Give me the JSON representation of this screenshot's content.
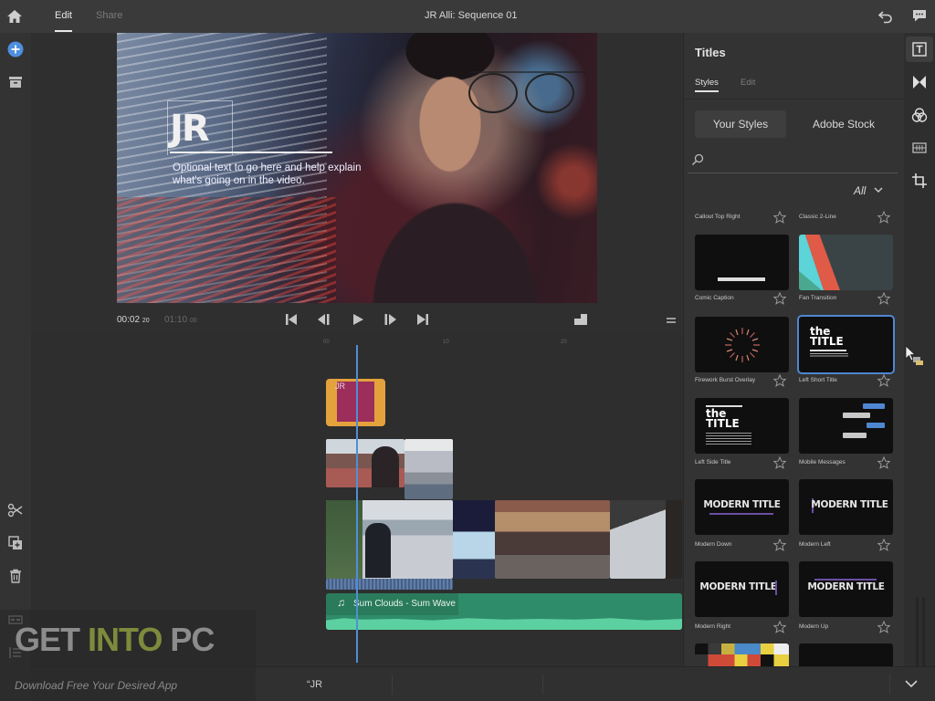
{
  "topbar": {
    "tabs": [
      {
        "label": "Edit",
        "active": true
      },
      {
        "label": "Share",
        "active": false
      }
    ],
    "sequence_title": "JR Alli: Sequence 01"
  },
  "viewer": {
    "overlay": {
      "logo_text": "JR",
      "subtitle": "Optional text to go here and help explain what's going on in the video."
    },
    "timecode_current": "00:02",
    "timecode_current_frames": "20",
    "timecode_total": "01:10",
    "timecode_total_frames": "00"
  },
  "timeline": {
    "ruler_ticks": [
      "00",
      "10",
      "20"
    ],
    "title_clip_label": "JR",
    "audio_clip": {
      "icon": "music-note-icon",
      "title": "Sum Clouds - Sum Wave"
    }
  },
  "bottombar": {
    "label": "“JR"
  },
  "watermark": {
    "word1": "GET ",
    "word2": "INTO",
    "word3": " PC",
    "tagline": "Download Free Your Desired App"
  },
  "panel": {
    "title": "Titles",
    "tabs": [
      {
        "label": "Styles",
        "active": true
      },
      {
        "label": "Edit",
        "active": false
      }
    ],
    "segments": [
      {
        "label": "Your Styles",
        "active": true
      },
      {
        "label": "Adobe Stock",
        "active": false
      }
    ],
    "search": {
      "value": "",
      "placeholder": ""
    },
    "filter": "All",
    "styles": [
      {
        "name": "Callout Top Right",
        "thumb_text": ""
      },
      {
        "name": "Classic 2-Line",
        "thumb_text": ""
      },
      {
        "name": "Comic Caption",
        "thumb_text": ""
      },
      {
        "name": "Fan Transition",
        "thumb_text": ""
      },
      {
        "name": "Firework Burst Overlay",
        "thumb_text": ""
      },
      {
        "name": "Left Short Title",
        "thumb_text": "the TITLE",
        "selected": true
      },
      {
        "name": "Left Side Title",
        "thumb_text": "the TITLE"
      },
      {
        "name": "Mobile Messages",
        "thumb_text": ""
      },
      {
        "name": "Modern Down",
        "thumb_text": "MODERN TITLE"
      },
      {
        "name": "Modern Left",
        "thumb_text": "MODERN TITLE"
      },
      {
        "name": "Modern Right",
        "thumb_text": "MODERN TITLE"
      },
      {
        "name": "Modern Up",
        "thumb_text": "MODERN TITLE"
      }
    ]
  },
  "colors": {
    "accent_blue": "#4f86d2",
    "title_clip": "#e4a23c",
    "title_clip_inner": "#9b2e5a",
    "audio_clip": "#2f8c6a",
    "modern_bar": "#6c4fa0"
  }
}
